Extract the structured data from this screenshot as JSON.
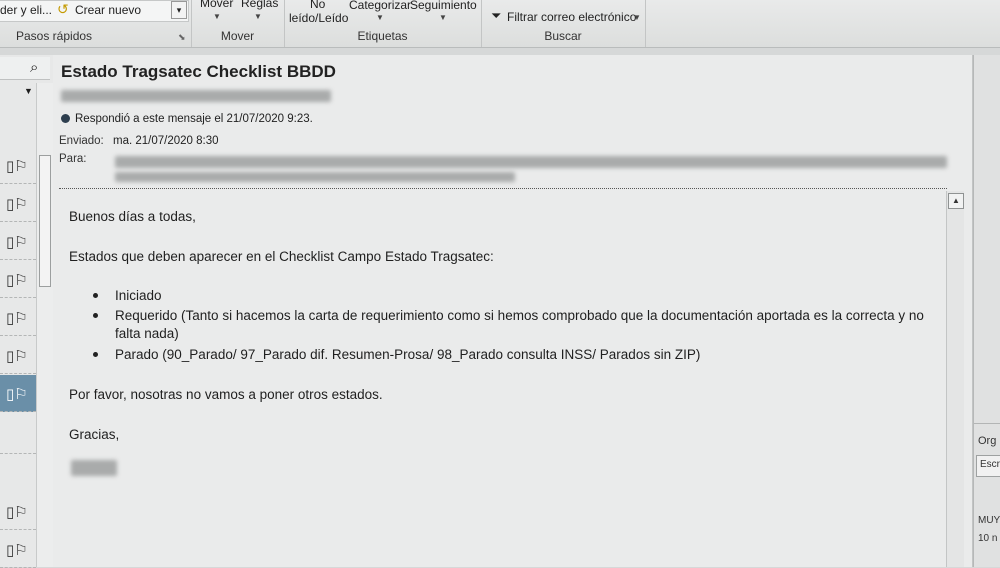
{
  "ribbon": {
    "quick_steps": {
      "partial_item": "der y eli...",
      "create_new": "Crear nuevo",
      "group_label": "Pasos rápidos"
    },
    "move": {
      "move_label": "Mover",
      "rules_label": "Reglas",
      "group_label": "Mover"
    },
    "tags": {
      "unread_line1": "No",
      "unread_line2": "leído/Leído",
      "categorize_label": "Categorizar",
      "followup_label": "Seguimiento",
      "group_label": "Etiquetas"
    },
    "find": {
      "filter_label": "Filtrar correo electrónico",
      "group_label": "Buscar"
    }
  },
  "message": {
    "subject": "Estado Tragsatec Checklist BBDD",
    "replied_notice": "Respondió a este mensaje el 21/07/2020 9:23.",
    "sent_label": "Enviado:",
    "sent_value": "ma. 21/07/2020 8:30",
    "to_label": "Para:",
    "greeting": "Buenos días a todas,",
    "intro": "Estados que deben aparecer en el Checklist Campo Estado Tragsatec:",
    "bullets": [
      "Iniciado",
      "Requerido (Tanto si hacemos la carta de requerimiento como si hemos comprobado que la documentación aportada es la correcta y no falta nada)",
      "Parado (90_Parado/ 97_Parado dif. Resumen-Prosa/ 98_Parado consulta INSS/ Parados sin ZIP)"
    ],
    "note": "Por favor, nosotras no vamos a poner otros estados.",
    "closing": "Gracias,"
  },
  "right_rail": {
    "line1": "Org",
    "line2": "Escr",
    "line3": "MUY",
    "line4": "10 n"
  },
  "icons": {
    "search": "search-icon",
    "filter": "funnel-icon",
    "mail_flag": "mail-flag-icon"
  }
}
